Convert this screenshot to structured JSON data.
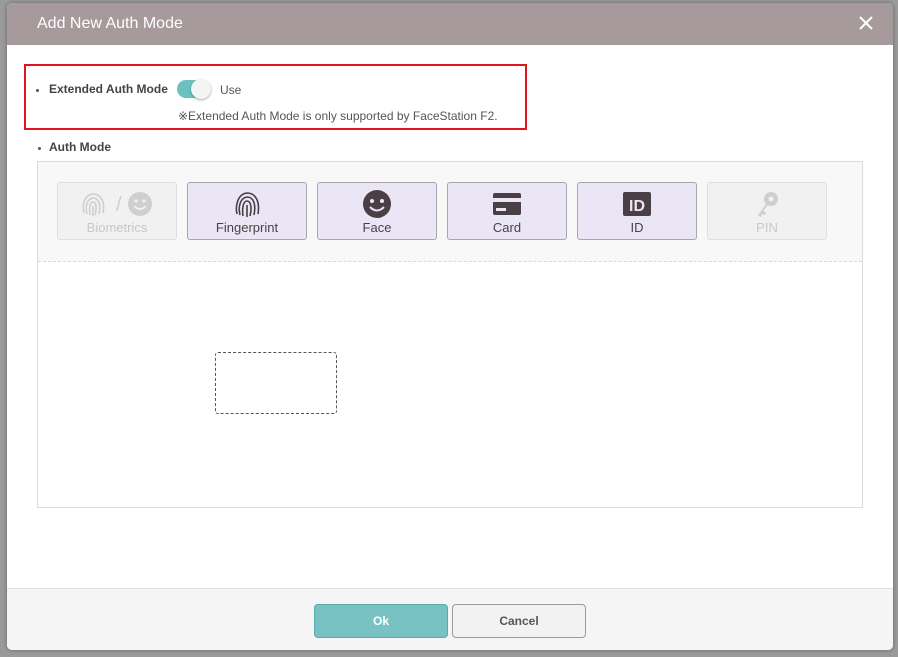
{
  "dialog": {
    "title": "Add New Auth Mode",
    "close_icon": "close-icon"
  },
  "extended_auth": {
    "label": "Extended Auth Mode",
    "toggle_state": "on",
    "toggle_text": "Use",
    "note": "※Extended Auth Mode is only supported by FaceStation F2."
  },
  "auth_mode": {
    "label": "Auth Mode",
    "buttons": [
      {
        "label": "Biometrics",
        "icon": "biometrics-icon",
        "enabled": false
      },
      {
        "label": "Fingerprint",
        "icon": "fingerprint-icon",
        "enabled": true
      },
      {
        "label": "Face",
        "icon": "face-icon",
        "enabled": true
      },
      {
        "label": "Card",
        "icon": "card-icon",
        "enabled": true
      },
      {
        "label": "ID",
        "icon": "id-icon",
        "enabled": true
      },
      {
        "label": "PIN",
        "icon": "key-icon",
        "enabled": false
      }
    ],
    "separator": "/"
  },
  "footer": {
    "ok_label": "Ok",
    "cancel_label": "Cancel"
  },
  "colors": {
    "header": "#a69a9c",
    "highlight": "#e0141e",
    "toggle_on": "#6bc1c0",
    "ok_button": "#79c2c4",
    "mode_button": "#ebe6f5",
    "icon_dark": "#4a3f45"
  }
}
